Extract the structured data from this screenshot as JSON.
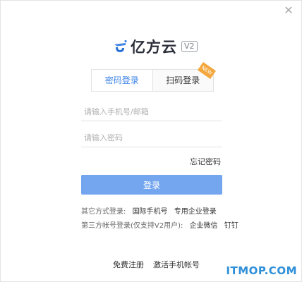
{
  "window": {
    "close_icon": "close-icon"
  },
  "brand": {
    "name": "亿方云",
    "version": "V2",
    "accent": "#3c84e6"
  },
  "tabs": [
    {
      "label": "密码登录",
      "active": true
    },
    {
      "label": "扫码登录",
      "active": false,
      "badge": "NEW"
    }
  ],
  "form": {
    "phone_placeholder": "请输入手机号/邮箱",
    "password_placeholder": "请输入密码",
    "forgot_label": "忘记密码",
    "login_label": "登录"
  },
  "other_login": {
    "prefix": "其它方式登录:",
    "options": [
      "国际手机号",
      "专用企业登录"
    ]
  },
  "third_party_login": {
    "prefix": "第三方帐号登录(仅支持V2用户):",
    "options": [
      "企业微信",
      "钉钉"
    ]
  },
  "footer": {
    "register": "免费注册",
    "activate": "激活手机帐号"
  },
  "watermark": "ITMOP.COM",
  "colors": {
    "login_button": "#74a6ef",
    "badge": "#f3a73c",
    "watermark": "#2f8fd8"
  }
}
